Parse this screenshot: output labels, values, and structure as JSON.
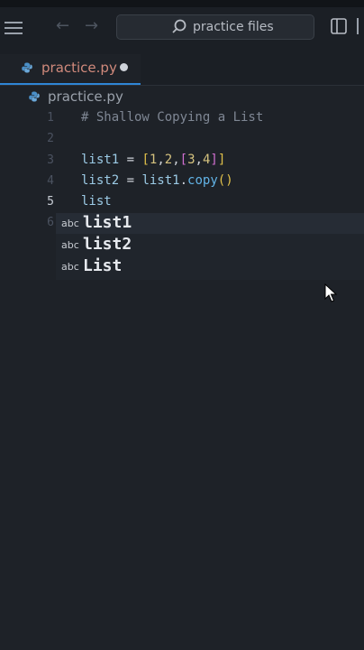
{
  "titlebar": {
    "search_text": "practice files"
  },
  "tabs": [
    {
      "label": "practice.py",
      "modified": true
    }
  ],
  "breadcrumb": {
    "file": "practice.py"
  },
  "editor": {
    "current_line": "5",
    "lines": [
      {
        "num": "1",
        "comment": "# Shallow Copying a List"
      },
      {
        "num": "2"
      },
      {
        "num": "3",
        "var": "list1",
        "eq": " = ",
        "b1": "[",
        "n1": "1",
        "c1": ",",
        "n2": "2",
        "c2": ",",
        "b2": "[",
        "n3": "3",
        "c3": ",",
        "n4": "4",
        "b3": "]",
        "b4": "]"
      },
      {
        "num": "4",
        "var": "list2",
        "eq": " = ",
        "obj": "list1",
        "dot": ".",
        "fn": "copy",
        "paren": "()"
      },
      {
        "num": "5",
        "var": "list"
      },
      {
        "num": "6"
      }
    ]
  },
  "suggestions": [
    {
      "kind": "abc",
      "label": "list1"
    },
    {
      "kind": "abc",
      "label": "list2"
    },
    {
      "kind": "abc",
      "label": "List"
    }
  ],
  "colors": {
    "background": "#1e2228",
    "accent": "#2f86d6",
    "tab_text": "#d18a7c",
    "python_icon": "#4a8fc7"
  },
  "icons": [
    "menu-icon",
    "arrow-left-icon",
    "arrow-right-icon",
    "search-icon",
    "split-layout-icon",
    "python-file-icon",
    "mouse-pointer-icon"
  ]
}
